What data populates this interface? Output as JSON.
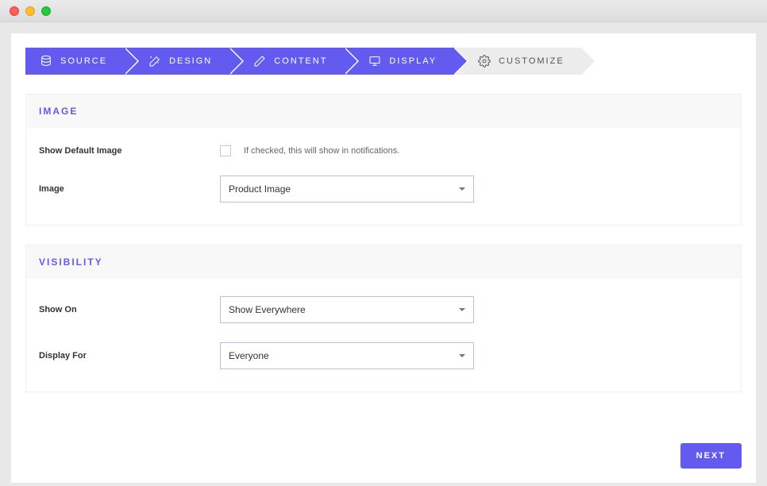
{
  "steps": {
    "source": "SOURCE",
    "design": "DESIGN",
    "content": "CONTENT",
    "display": "DISPLAY",
    "customize": "CUSTOMIZE"
  },
  "sections": {
    "image": {
      "title": "IMAGE",
      "showDefaultLabel": "Show Default Image",
      "showDefaultHint": "If checked, this will show in notifications.",
      "showDefaultChecked": false,
      "imageLabel": "Image",
      "imageValue": "Product Image"
    },
    "visibility": {
      "title": "VISIBILITY",
      "showOnLabel": "Show On",
      "showOnValue": "Show Everywhere",
      "displayForLabel": "Display For",
      "displayForValue": "Everyone"
    }
  },
  "footer": {
    "nextLabel": "NEXT"
  }
}
